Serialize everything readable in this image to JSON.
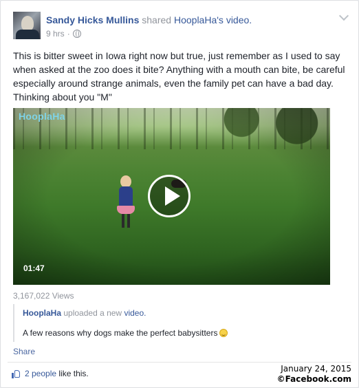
{
  "post": {
    "author": "Sandy Hicks Mullins",
    "shared_word": "shared",
    "page_name": "HooplaHa",
    "possessive": "'s",
    "video_word": "video.",
    "time": "9 hrs",
    "separator": "·",
    "text": "This is bitter sweet in Iowa right now but true, just remember as I used to say when asked at the zoo does it bite? Anything with a mouth can bite, be careful especially around strange animals, even the family pet can have a bad day. Thinking about you \"M\""
  },
  "video": {
    "brand": "HooplaHa",
    "duration": "01:47",
    "views": "3,167,022 Views"
  },
  "shared_item": {
    "page_name": "HooplaHa",
    "action": "uploaded a new",
    "object": "video.",
    "description": "A few reasons why dogs make the perfect babysitters"
  },
  "actions": {
    "share": "Share"
  },
  "likes": {
    "count": "2 people",
    "suffix": "like this."
  },
  "stamp": {
    "date": "January 24, 2015",
    "copyright": "©Facebook.com"
  },
  "icons": [
    "avatar",
    "globe-icon",
    "chevron-down-icon",
    "play-icon",
    "like-thumb-icon",
    "smile-emoji-icon"
  ],
  "colors": {
    "link": "#365899",
    "muted": "#90949c",
    "like": "#4267b2"
  }
}
